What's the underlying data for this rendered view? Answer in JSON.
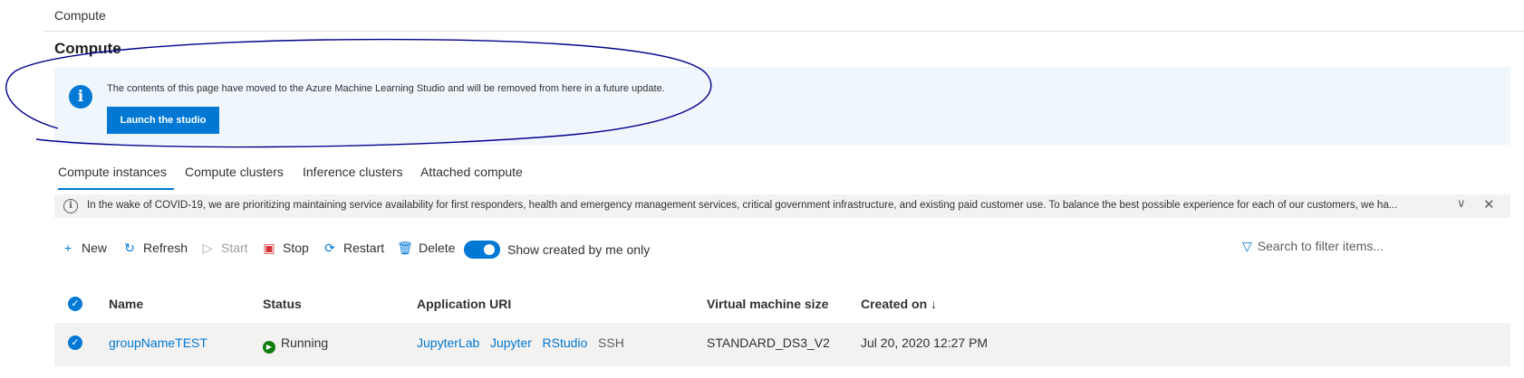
{
  "breadcrumb": "Compute",
  "page_title": "Compute",
  "banner": {
    "message": "The contents of this page have moved to the Azure Machine Learning Studio and will be removed from here in a future update.",
    "button_label": "Launch the studio"
  },
  "tabs": [
    {
      "label": "Compute instances",
      "active": true
    },
    {
      "label": "Compute clusters",
      "active": false
    },
    {
      "label": "Inference clusters",
      "active": false
    },
    {
      "label": "Attached compute",
      "active": false
    }
  ],
  "notice": {
    "text": "In the wake of COVID-19, we are prioritizing maintaining service availability for first responders, health and emergency management services, critical government infrastructure, and existing paid customer use. To balance the best possible experience for each of our customers, we ha..."
  },
  "toolbar": {
    "new_label": "New",
    "refresh_label": "Refresh",
    "start_label": "Start",
    "stop_label": "Stop",
    "restart_label": "Restart",
    "delete_label": "Delete",
    "toggle_label": "Show created by me only",
    "toggle_on": true,
    "search_placeholder": "Search to filter items..."
  },
  "table": {
    "headers": {
      "name": "Name",
      "status": "Status",
      "uri": "Application URI",
      "vm_size": "Virtual machine size",
      "created": "Created on ↓"
    },
    "rows": [
      {
        "name": "groupNameTEST",
        "status": "Running",
        "uri_links": [
          "JupyterLab",
          "Jupyter",
          "RStudio"
        ],
        "uri_ssh": "SSH",
        "vm_size": "STANDARD_DS3_V2",
        "created": "Jul 20, 2020 12:27 PM"
      }
    ]
  },
  "colors": {
    "accent": "#0078d4",
    "banner_bg": "#eff6fc",
    "annotation": "#00008b",
    "running": "#107c10"
  }
}
